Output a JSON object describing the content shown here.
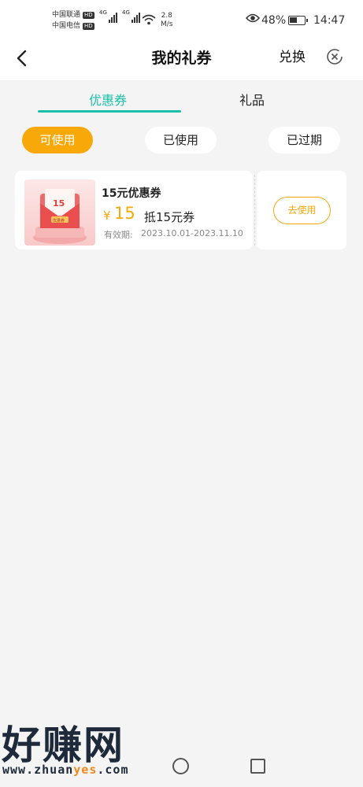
{
  "status_bar": {
    "carrier_1": "中国联通",
    "carrier_2": "中国电信",
    "hd_badge": "HD",
    "signal_tag": "4G",
    "net_speed_value": "2.8",
    "net_speed_unit": "M/s",
    "battery_percent": "48%",
    "battery_level": 0.48,
    "time": "14:47",
    "icons": [
      "signal-icon",
      "wifi-icon",
      "eye-icon",
      "battery-icon"
    ]
  },
  "header": {
    "title": "我的礼券",
    "exchange_label": "兑换",
    "back_icon": "chevron-left-icon",
    "close_icon": "close-circle-icon"
  },
  "tabs": [
    {
      "label": "优惠券",
      "active": true
    },
    {
      "label": "礼品",
      "active": false
    }
  ],
  "filters": [
    {
      "label": "可使用",
      "active": true
    },
    {
      "label": "已使用",
      "active": false
    },
    {
      "label": "已过期",
      "active": false
    }
  ],
  "coupons": [
    {
      "name": "15元优惠券",
      "currency": "¥",
      "amount": "15",
      "description": "抵15元券",
      "valid_label": "有效期:",
      "valid_range": "2023.10.01-2023.11.10",
      "thumb_number": "15",
      "thumb_tag": "优惠券",
      "action_label": "去使用"
    }
  ],
  "watermark": {
    "big": "好赚网",
    "url_part1": "www.zhuan",
    "url_highlight": "yes",
    "url_part2": ".com"
  },
  "colors": {
    "accent_teal": "#1bbfa8",
    "accent_orange": "#f9a80a",
    "background": "#f4f4f4"
  }
}
